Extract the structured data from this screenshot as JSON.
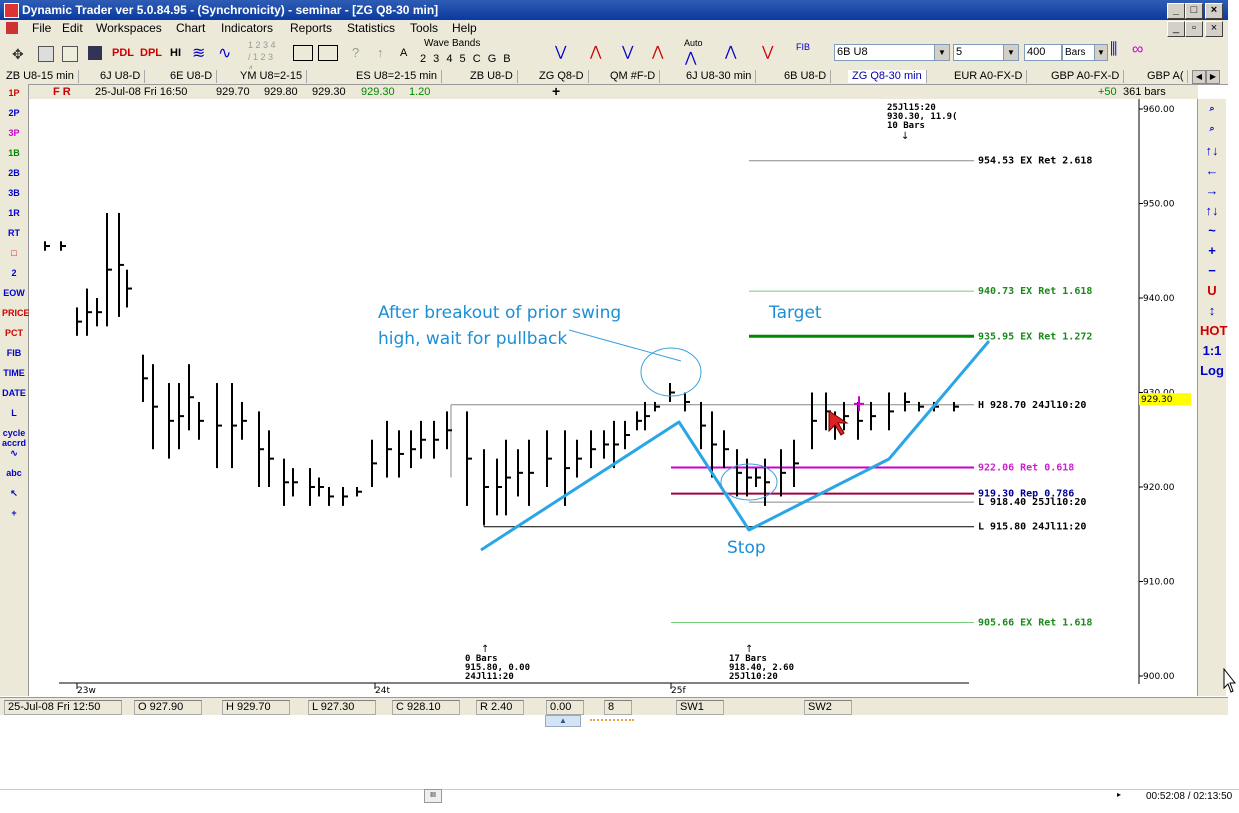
{
  "window": {
    "title": "Dynamic Trader ver 5.0.84.95 - (Synchronicity) - seminar - [ZG Q8-30 min]"
  },
  "menu": [
    "File",
    "Edit",
    "Workspaces",
    "Chart",
    "Indicators",
    "Reports",
    "Statistics",
    "Tools",
    "Help"
  ],
  "toolbar": {
    "pdl": "PDL",
    "dpl": "DPL",
    "hi": "HI",
    "wave_bands": "Wave Bands",
    "wave_nums": "2 3 4 5 C G B",
    "num_left": "1 2 3 4 / 1 2 3 4",
    "letter_a": "A",
    "auto": "Auto",
    "fib": "FIB",
    "symbol": "6B U8",
    "interval": "5",
    "bars_count": "400",
    "bars_unit": "Bars"
  },
  "tabs": [
    "ZB U8-15 min",
    "6J U8-D",
    "6E U8-D",
    "YM U8=2-15",
    "ES U8=2-15 min",
    "ZB U8-D",
    "ZG Q8-D",
    "QM #F-D",
    "6J U8-30 min",
    "6B U8-D",
    "ZG Q8-30 min",
    "EUR A0-FX-D",
    "GBP A0-FX-D",
    "GBP A("
  ],
  "active_tab_index": 10,
  "infobar": {
    "flags": "F R",
    "date": "25-Jul-08 Fri 16:50",
    "open": "929.70",
    "high": "929.80",
    "low": "929.30",
    "close": "929.30",
    "change": "1.20",
    "plus": "+50",
    "bars": "361 bars"
  },
  "left_tools": [
    "1P",
    "2P",
    "3P",
    "1B",
    "2B",
    "3B",
    "1R",
    "RT",
    "□",
    "2",
    "EOW",
    "PRICE",
    "PCT",
    "FIB",
    "TIME",
    "DATE",
    "L",
    "cycle accrd",
    "∿",
    "abc",
    "↖",
    "+"
  ],
  "right_tools": [
    "zoom-in",
    "zoom-out",
    "↑↓",
    "←",
    "→",
    "↑↓",
    "~",
    "+",
    "−",
    "U",
    "↕",
    "HOT",
    "1:1",
    "Log"
  ],
  "chart": {
    "y_ticks": [
      "960.00",
      "950.00",
      "940.00",
      "930.00",
      "920.00",
      "910.00",
      "900.00"
    ],
    "price_label": "929.30",
    "x_labels": [
      "23w",
      "24t",
      "25f"
    ],
    "levels": [
      {
        "label": "954.53 EX Ret 2.618",
        "color": "#000000"
      },
      {
        "label": "940.73 EX Ret 1.618",
        "color": "#1a8a1a"
      },
      {
        "label": "935.95 EX Ret 1.272",
        "color": "#1a8a1a"
      },
      {
        "label": "H 928.70 24Jl10:20",
        "color": "#000000"
      },
      {
        "label": "922.06 Ret 0.618",
        "color": "#cc22cc"
      },
      {
        "label": "919.30 Rep 0.786",
        "color": "#000099"
      },
      {
        "label": "L 918.40 25Jl10:20",
        "color": "#000000"
      },
      {
        "label": "L 915.80 24Jl11:20",
        "color": "#000000"
      },
      {
        "label": "905.66 EX Ret 1.618",
        "color": "#1a8a1a"
      }
    ],
    "top_marker": [
      "25Jl15:20",
      "930.30, 11.9(",
      "10 Bars"
    ],
    "marker_left": [
      "0 Bars",
      "915.80, 0.00",
      "24Jl11:20"
    ],
    "marker_mid": [
      "17 Bars",
      "918.40, 2.60",
      "25Jl10:20"
    ],
    "annotations": {
      "pullback_1": "After breakout of prior swing",
      "pullback_2": "high, wait for pullback",
      "target": "Target",
      "stop": "Stop"
    }
  },
  "statusbar": {
    "date": "25-Jul-08 Fri 12:50",
    "open": "O 927.90",
    "high": "H 929.70",
    "low": "L 927.30",
    "close": "C 928.10",
    "range": "R 2.40",
    "zero": "0.00",
    "eight": "8",
    "sw1": "SW1",
    "sw2": "SW2"
  },
  "player": {
    "time": "00:52:08 / 02:13:50",
    "handle": "III"
  },
  "colors": {
    "accent_blue": "#1b8fd6",
    "price_highlight": "#ffff00"
  }
}
